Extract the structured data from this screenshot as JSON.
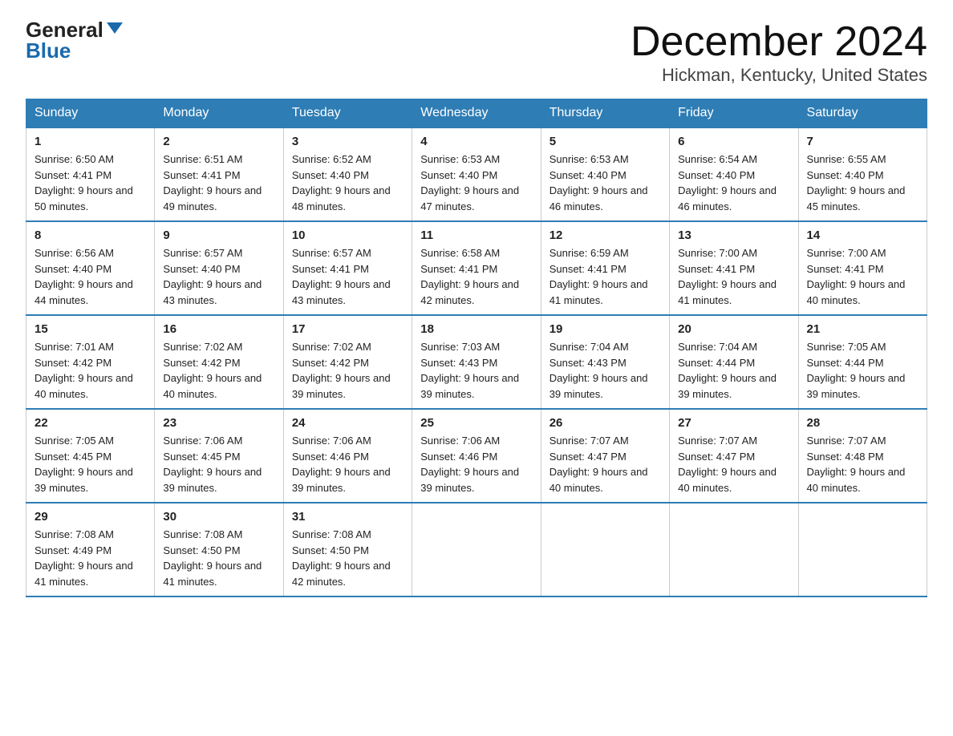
{
  "header": {
    "logo_general": "General",
    "logo_blue": "Blue",
    "month_title": "December 2024",
    "location": "Hickman, Kentucky, United States"
  },
  "days_of_week": [
    "Sunday",
    "Monday",
    "Tuesday",
    "Wednesday",
    "Thursday",
    "Friday",
    "Saturday"
  ],
  "weeks": [
    [
      {
        "day": "1",
        "sunrise": "6:50 AM",
        "sunset": "4:41 PM",
        "daylight": "9 hours and 50 minutes."
      },
      {
        "day": "2",
        "sunrise": "6:51 AM",
        "sunset": "4:41 PM",
        "daylight": "9 hours and 49 minutes."
      },
      {
        "day": "3",
        "sunrise": "6:52 AM",
        "sunset": "4:40 PM",
        "daylight": "9 hours and 48 minutes."
      },
      {
        "day": "4",
        "sunrise": "6:53 AM",
        "sunset": "4:40 PM",
        "daylight": "9 hours and 47 minutes."
      },
      {
        "day": "5",
        "sunrise": "6:53 AM",
        "sunset": "4:40 PM",
        "daylight": "9 hours and 46 minutes."
      },
      {
        "day": "6",
        "sunrise": "6:54 AM",
        "sunset": "4:40 PM",
        "daylight": "9 hours and 46 minutes."
      },
      {
        "day": "7",
        "sunrise": "6:55 AM",
        "sunset": "4:40 PM",
        "daylight": "9 hours and 45 minutes."
      }
    ],
    [
      {
        "day": "8",
        "sunrise": "6:56 AM",
        "sunset": "4:40 PM",
        "daylight": "9 hours and 44 minutes."
      },
      {
        "day": "9",
        "sunrise": "6:57 AM",
        "sunset": "4:40 PM",
        "daylight": "9 hours and 43 minutes."
      },
      {
        "day": "10",
        "sunrise": "6:57 AM",
        "sunset": "4:41 PM",
        "daylight": "9 hours and 43 minutes."
      },
      {
        "day": "11",
        "sunrise": "6:58 AM",
        "sunset": "4:41 PM",
        "daylight": "9 hours and 42 minutes."
      },
      {
        "day": "12",
        "sunrise": "6:59 AM",
        "sunset": "4:41 PM",
        "daylight": "9 hours and 41 minutes."
      },
      {
        "day": "13",
        "sunrise": "7:00 AM",
        "sunset": "4:41 PM",
        "daylight": "9 hours and 41 minutes."
      },
      {
        "day": "14",
        "sunrise": "7:00 AM",
        "sunset": "4:41 PM",
        "daylight": "9 hours and 40 minutes."
      }
    ],
    [
      {
        "day": "15",
        "sunrise": "7:01 AM",
        "sunset": "4:42 PM",
        "daylight": "9 hours and 40 minutes."
      },
      {
        "day": "16",
        "sunrise": "7:02 AM",
        "sunset": "4:42 PM",
        "daylight": "9 hours and 40 minutes."
      },
      {
        "day": "17",
        "sunrise": "7:02 AM",
        "sunset": "4:42 PM",
        "daylight": "9 hours and 39 minutes."
      },
      {
        "day": "18",
        "sunrise": "7:03 AM",
        "sunset": "4:43 PM",
        "daylight": "9 hours and 39 minutes."
      },
      {
        "day": "19",
        "sunrise": "7:04 AM",
        "sunset": "4:43 PM",
        "daylight": "9 hours and 39 minutes."
      },
      {
        "day": "20",
        "sunrise": "7:04 AM",
        "sunset": "4:44 PM",
        "daylight": "9 hours and 39 minutes."
      },
      {
        "day": "21",
        "sunrise": "7:05 AM",
        "sunset": "4:44 PM",
        "daylight": "9 hours and 39 minutes."
      }
    ],
    [
      {
        "day": "22",
        "sunrise": "7:05 AM",
        "sunset": "4:45 PM",
        "daylight": "9 hours and 39 minutes."
      },
      {
        "day": "23",
        "sunrise": "7:06 AM",
        "sunset": "4:45 PM",
        "daylight": "9 hours and 39 minutes."
      },
      {
        "day": "24",
        "sunrise": "7:06 AM",
        "sunset": "4:46 PM",
        "daylight": "9 hours and 39 minutes."
      },
      {
        "day": "25",
        "sunrise": "7:06 AM",
        "sunset": "4:46 PM",
        "daylight": "9 hours and 39 minutes."
      },
      {
        "day": "26",
        "sunrise": "7:07 AM",
        "sunset": "4:47 PM",
        "daylight": "9 hours and 40 minutes."
      },
      {
        "day": "27",
        "sunrise": "7:07 AM",
        "sunset": "4:47 PM",
        "daylight": "9 hours and 40 minutes."
      },
      {
        "day": "28",
        "sunrise": "7:07 AM",
        "sunset": "4:48 PM",
        "daylight": "9 hours and 40 minutes."
      }
    ],
    [
      {
        "day": "29",
        "sunrise": "7:08 AM",
        "sunset": "4:49 PM",
        "daylight": "9 hours and 41 minutes."
      },
      {
        "day": "30",
        "sunrise": "7:08 AM",
        "sunset": "4:50 PM",
        "daylight": "9 hours and 41 minutes."
      },
      {
        "day": "31",
        "sunrise": "7:08 AM",
        "sunset": "4:50 PM",
        "daylight": "9 hours and 42 minutes."
      },
      null,
      null,
      null,
      null
    ]
  ]
}
